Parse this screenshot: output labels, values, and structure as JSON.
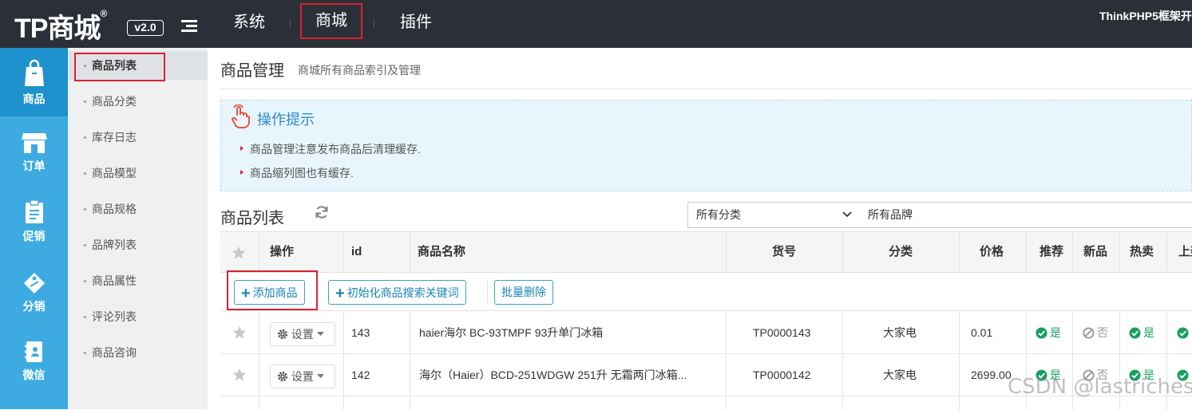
{
  "header": {
    "logo_text": "TP商城",
    "registered": "®",
    "version": "v2.0",
    "nav": [
      "系统",
      "商城",
      "插件"
    ],
    "right_text": "ThinkPHP5框架开"
  },
  "leftbar": {
    "items": [
      {
        "label": "商品",
        "icon": "shopping-bag-icon"
      },
      {
        "label": "订单",
        "icon": "store-icon"
      },
      {
        "label": "促销",
        "icon": "clipboard-icon"
      },
      {
        "label": "分销",
        "icon": "tag-icon"
      },
      {
        "label": "微信",
        "icon": "notebook-icon"
      }
    ]
  },
  "submenu": {
    "items": [
      "商品列表",
      "商品分类",
      "库存日志",
      "商品模型",
      "商品规格",
      "品牌列表",
      "商品属性",
      "评论列表",
      "商品咨询"
    ]
  },
  "page": {
    "title": "商品管理",
    "subtitle": "商城所有商品索引及管理"
  },
  "tips": {
    "title": "操作提示",
    "items": [
      "商品管理注意发布商品后清理缓存.",
      "商品缩列图也有缓存."
    ]
  },
  "list": {
    "title": "商品列表",
    "category_select": "所有分类",
    "brand_select": "所有品牌"
  },
  "table": {
    "columns": [
      "操作",
      "id",
      "商品名称",
      "货号",
      "分类",
      "价格",
      "推荐",
      "新品",
      "热卖",
      "上架"
    ],
    "buttons": {
      "add": "添加商品",
      "init_keywords": "初始化商品搜索关键词",
      "batch_delete": "批量删除"
    },
    "settings_label": "设置",
    "rows": [
      {
        "id": "143",
        "name": "haier海尔 BC-93TMPF 93升单门冰箱",
        "sku": "TP0000143",
        "category": "大家电",
        "price": "0.01",
        "recommend": "是",
        "new": "否",
        "hot": "是"
      },
      {
        "id": "142",
        "name": "海尔（Haier）BCD-251WDGW 251升 无霜两门冰箱...",
        "sku": "TP0000142",
        "category": "大家电",
        "price": "2699.00",
        "recommend": "是",
        "new": "否",
        "hot": "是"
      }
    ]
  },
  "watermark": "CSDN @lastriches",
  "colors": {
    "topbar": "#2b3038",
    "leftbar": "#3dabe1",
    "highlight": "#d9232d",
    "accent": "#1a86b4",
    "yes": "#18a05d"
  }
}
